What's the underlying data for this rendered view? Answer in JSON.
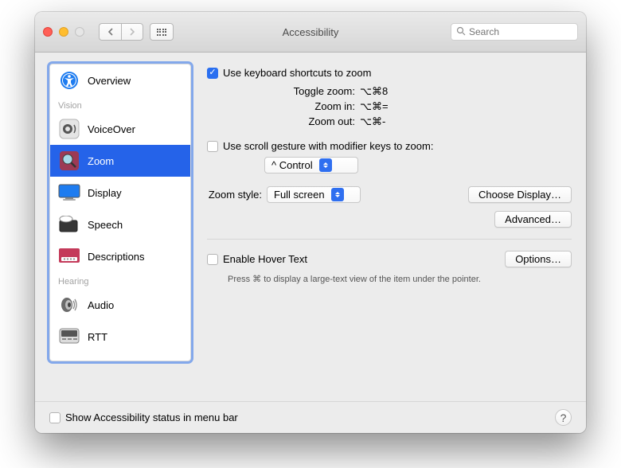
{
  "window": {
    "title": "Accessibility"
  },
  "toolbar": {
    "search_placeholder": "Search"
  },
  "sidebar": {
    "overview_label": "Overview",
    "groups": {
      "vision": "Vision",
      "hearing": "Hearing"
    },
    "items": {
      "voiceover": "VoiceOver",
      "zoom": "Zoom",
      "display": "Display",
      "speech": "Speech",
      "descriptions": "Descriptions",
      "audio": "Audio",
      "rtt": "RTT"
    }
  },
  "main": {
    "use_keyboard_shortcuts": "Use keyboard shortcuts to zoom",
    "shortcuts": {
      "toggle_label": "Toggle zoom:",
      "toggle_value": "⌥⌘8",
      "zoom_in_label": "Zoom in:",
      "zoom_in_value": "⌥⌘=",
      "zoom_out_label": "Zoom out:",
      "zoom_out_value": "⌥⌘-"
    },
    "use_scroll_gesture": "Use scroll gesture with modifier keys to zoom:",
    "modifier_selected": "^ Control",
    "zoom_style_label": "Zoom style:",
    "zoom_style_selected": "Full screen",
    "choose_display": "Choose Display…",
    "advanced": "Advanced…",
    "enable_hover_text": "Enable Hover Text",
    "options": "Options…",
    "hover_hint": "Press ⌘ to display a large-text view of the item under the pointer."
  },
  "footer": {
    "show_status": "Show Accessibility status in menu bar"
  }
}
